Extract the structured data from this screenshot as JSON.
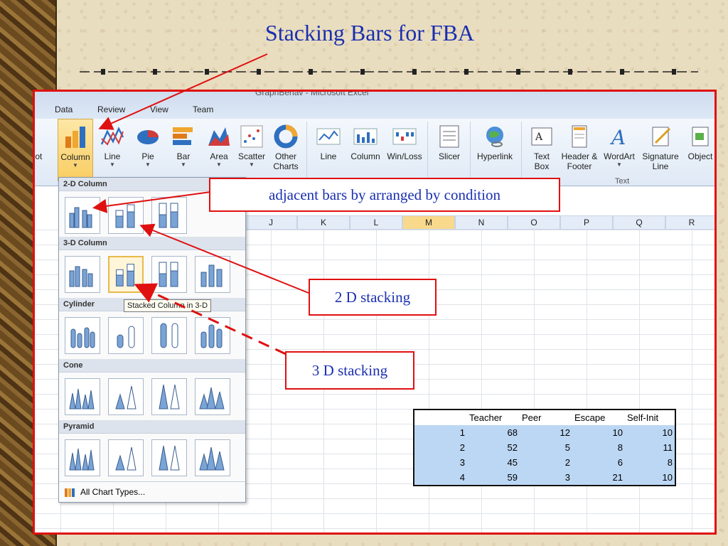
{
  "slide": {
    "title": "Stacking Bars for FBA"
  },
  "window": {
    "title": "GraphBehav - Microsoft Excel"
  },
  "tabs": [
    "Data",
    "Review",
    "View",
    "Team"
  ],
  "ribbon": {
    "cut_label": "hot",
    "charts": [
      {
        "label": "Column",
        "icon": "column-chart-icon",
        "active": true
      },
      {
        "label": "Line",
        "icon": "line-chart-icon"
      },
      {
        "label": "Pie",
        "icon": "pie-chart-icon"
      },
      {
        "label": "Bar",
        "icon": "bar-chart-icon"
      },
      {
        "label": "Area",
        "icon": "area-chart-icon"
      },
      {
        "label": "Scatter",
        "icon": "scatter-chart-icon"
      },
      {
        "label": "Other Charts",
        "icon": "other-charts-icon"
      }
    ],
    "sparklines": [
      {
        "label": "Line",
        "icon": "sparkline-line-icon"
      },
      {
        "label": "Column",
        "icon": "sparkline-column-icon"
      },
      {
        "label": "Win/Loss",
        "icon": "sparkline-winloss-icon"
      }
    ],
    "slicer_label": "Slicer",
    "hyperlink_label": "Hyperlink",
    "text_group": [
      {
        "label": "Text Box",
        "icon": "text-box-icon"
      },
      {
        "label": "Header & Footer",
        "icon": "header-footer-icon"
      },
      {
        "label": "WordArt",
        "icon": "wordart-icon"
      },
      {
        "label": "Signature Line",
        "icon": "signature-line-icon"
      },
      {
        "label": "Object",
        "icon": "object-icon"
      }
    ],
    "text_group_label": "Text"
  },
  "columns": [
    "J",
    "K",
    "L",
    "M",
    "N",
    "O",
    "P",
    "Q",
    "R"
  ],
  "selected_column": "M",
  "dropdown": {
    "sections": [
      "2-D Column",
      "3-D Column",
      "Cylinder",
      "Cone",
      "Pyramid"
    ],
    "tooltip": "Stacked Column in 3-D",
    "footer": "All Chart Types..."
  },
  "callouts": {
    "adjacent": "adjacent bars by arranged by condition",
    "stack2d": "2 D stacking",
    "stack3d": "3 D stacking"
  },
  "data_table": {
    "headers": [
      "",
      "Teacher",
      "Peer",
      "Escape",
      "Self-Init"
    ],
    "rows": [
      [
        "1",
        "68",
        "12",
        "10",
        "10"
      ],
      [
        "2",
        "52",
        "5",
        "8",
        "11"
      ],
      [
        "3",
        "45",
        "2",
        "6",
        "8"
      ],
      [
        "4",
        "59",
        "3",
        "21",
        "10"
      ]
    ]
  },
  "colors": {
    "title": "#1a2fb0",
    "frame": "#e01010",
    "selection": "#bcd7f4"
  }
}
